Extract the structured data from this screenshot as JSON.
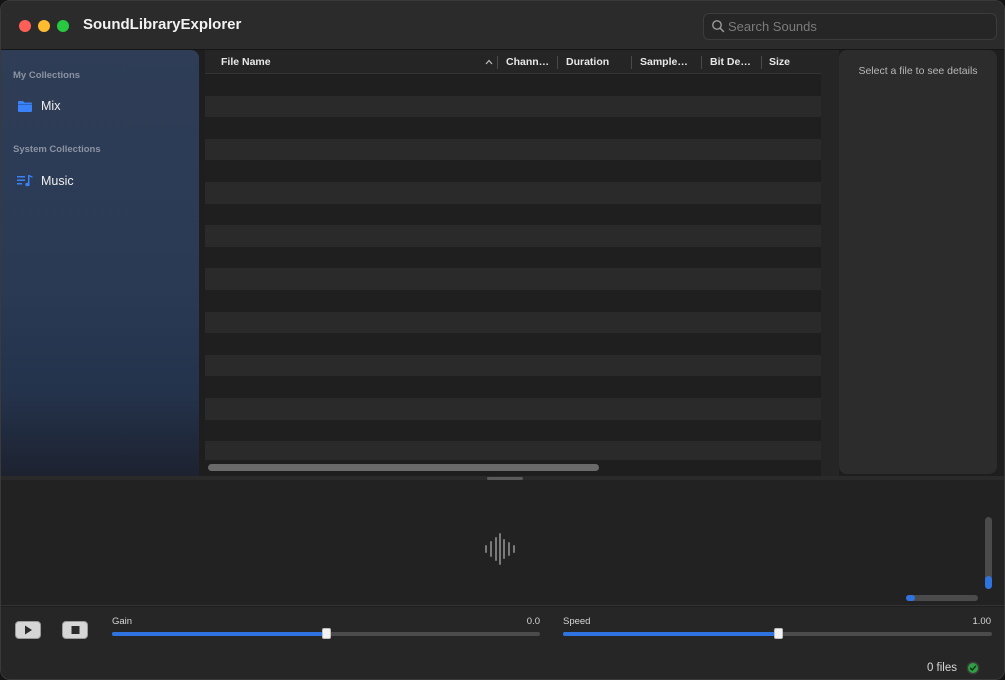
{
  "window": {
    "title": "SoundLibraryExplorer"
  },
  "search": {
    "placeholder": "Search Sounds",
    "value": ""
  },
  "sidebar": {
    "sections": [
      {
        "header": "My Collections",
        "items": [
          {
            "label": "Mix",
            "icon": "folder-icon"
          }
        ]
      },
      {
        "header": "System Collections",
        "items": [
          {
            "label": "Music",
            "icon": "music-list-icon"
          }
        ]
      }
    ]
  },
  "table": {
    "columns": [
      "File Name",
      "Chann…",
      "Duration",
      "Sample…",
      "Bit De…",
      "Size"
    ],
    "sorted_column": "File Name",
    "sort_direction": "ascending",
    "rows": []
  },
  "detail": {
    "empty_message": "Select a file to see details"
  },
  "playback": {
    "gain": {
      "label": "Gain",
      "value": "0.0",
      "fraction": 0.5
    },
    "speed": {
      "label": "Speed",
      "value": "1.00",
      "fraction": 0.5
    },
    "volume_level": 0.18,
    "position_progress": 0.12
  },
  "status": {
    "file_count": "0 files",
    "indicator": "ok"
  },
  "colors": {
    "accent": "#2f73e0",
    "traffic_red": "#ff5f57",
    "traffic_yellow": "#febc2e",
    "traffic_green": "#28c840",
    "status_ok": "#2ea043"
  }
}
